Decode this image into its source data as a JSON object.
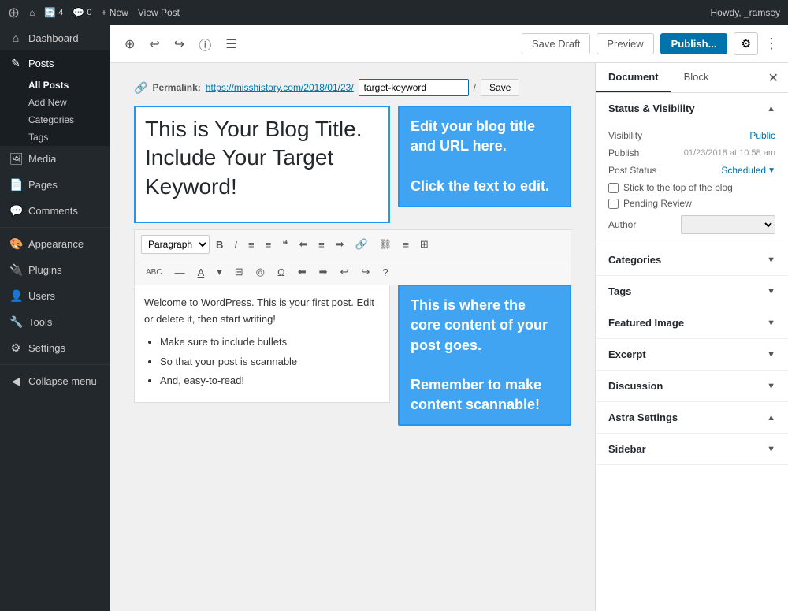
{
  "adminBar": {
    "logoSymbol": "W",
    "updates": "4",
    "comments": "0",
    "newLabel": "+ New",
    "viewPost": "View Post",
    "howdy": "Howdy, _ramsey"
  },
  "sidebar": {
    "items": [
      {
        "id": "dashboard",
        "icon": "⌂",
        "label": "Dashboard"
      },
      {
        "id": "posts",
        "icon": "✎",
        "label": "Posts",
        "active": true,
        "subs": [
          "All Posts",
          "Add New",
          "Categories",
          "Tags"
        ]
      },
      {
        "id": "media",
        "icon": "🖼",
        "label": "Media"
      },
      {
        "id": "pages",
        "icon": "📄",
        "label": "Pages"
      },
      {
        "id": "comments",
        "icon": "💬",
        "label": "Comments"
      },
      {
        "id": "appearance",
        "icon": "🎨",
        "label": "Appearance"
      },
      {
        "id": "plugins",
        "icon": "🔌",
        "label": "Plugins"
      },
      {
        "id": "users",
        "icon": "👤",
        "label": "Users"
      },
      {
        "id": "tools",
        "icon": "🔧",
        "label": "Tools"
      },
      {
        "id": "settings",
        "icon": "⚙",
        "label": "Settings"
      },
      {
        "id": "collapse",
        "icon": "◀",
        "label": "Collapse menu"
      }
    ]
  },
  "toolbar": {
    "saveDraftLabel": "Save Draft",
    "previewLabel": "Preview",
    "publishLabel": "Publish...",
    "gearSymbol": "⚙",
    "dotsSymbol": "⋮"
  },
  "editor": {
    "permalink": {
      "label": "Permalink:",
      "base": "https://misshistory.com/2018/01/23/",
      "slug": "target-keyword",
      "saveBtn": "Save"
    },
    "title": "This is Your Blog Title. Include Your Target Keyword!",
    "formatTools": {
      "paraLabel": "Paragraph",
      "buttons": [
        "B",
        "I",
        "≡",
        "≡",
        "❝",
        "≡",
        "≡",
        "≡",
        "🔗",
        "≋",
        "≡",
        "⊞",
        "ABC",
        "—",
        "A",
        "▾",
        "⊟",
        "◎",
        "Ω",
        "⬅",
        "➡",
        "↩",
        "↪",
        "?"
      ]
    },
    "content": {
      "intro": "Welcome to WordPress. This is your first post. Edit or delete it, then start writing!",
      "bullets": [
        "Make sure to include bullets",
        "So that your post is scannable",
        "And, easy-to-read!"
      ]
    },
    "titleAnnotation": {
      "line1": "Edit your blog title",
      "line2": "and URL here.",
      "line3": "Click the text to edit."
    },
    "contentAnnotation": {
      "line1": "This is where the core content of your post goes.",
      "line2": "Remember to make content scannable!"
    }
  },
  "rightPanel": {
    "tabs": [
      "Document",
      "Block"
    ],
    "sections": [
      {
        "id": "status-visibility",
        "label": "Status & Visibility",
        "expanded": true,
        "content": {
          "statusLabel": "Status",
          "statusValue": "Public",
          "scheduleTime": "01/23/2018 at 10:58 am",
          "scheduleLabel": "Scheduled",
          "checkboxes": [
            "Stick to the top of the blog",
            "Pending Review"
          ],
          "authorLabel": "Author"
        }
      },
      {
        "id": "categories",
        "label": "Categories",
        "expanded": false
      },
      {
        "id": "tags",
        "label": "Tags",
        "expanded": false
      },
      {
        "id": "featured-image",
        "label": "Featured Image",
        "expanded": false
      },
      {
        "id": "excerpt",
        "label": "Excerpt",
        "expanded": false
      },
      {
        "id": "discussion",
        "label": "Discussion",
        "expanded": false
      },
      {
        "id": "astra-settings",
        "label": "Astra Settings",
        "expanded": true
      },
      {
        "id": "sidebar",
        "label": "Sidebar",
        "expanded": false
      }
    ]
  }
}
